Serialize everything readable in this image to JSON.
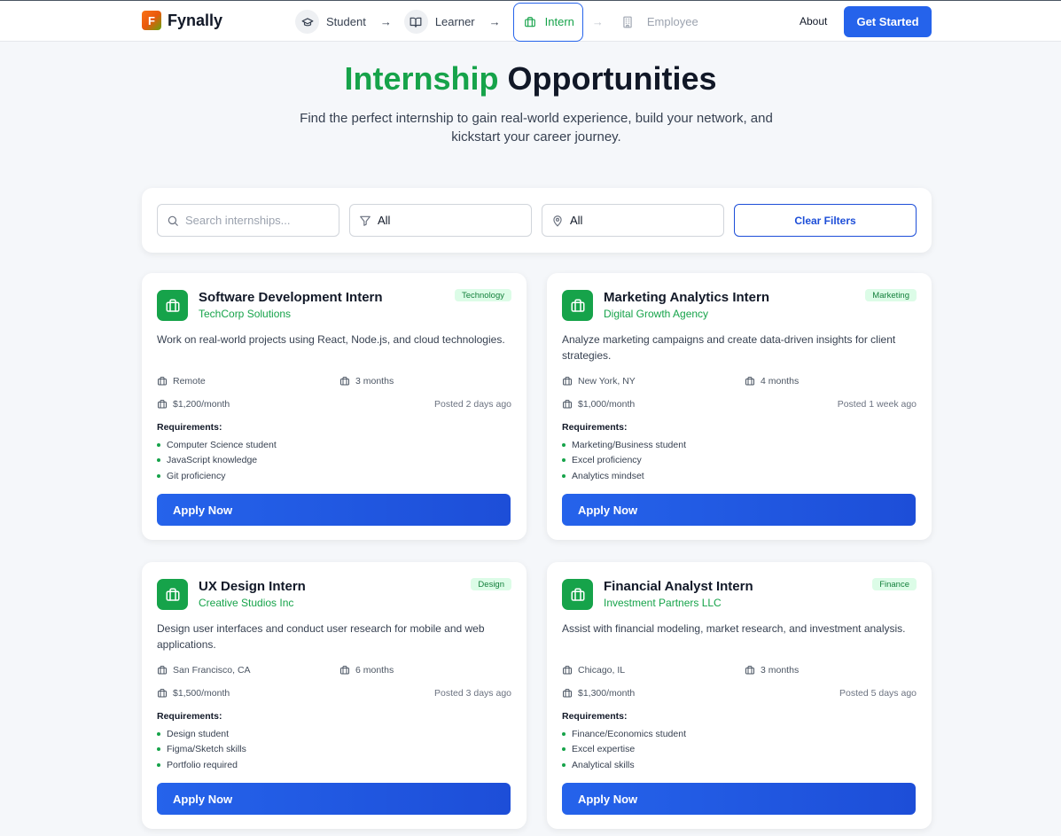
{
  "header": {
    "brand_letter": "F",
    "brand_name": "Fynally",
    "journey": [
      {
        "label": "Student",
        "icon": "graduation-cap-icon"
      },
      {
        "label": "Learner",
        "icon": "book-open-icon"
      },
      {
        "label": "Intern",
        "icon": "briefcase-icon"
      },
      {
        "label": "Employee",
        "icon": "building-icon"
      }
    ],
    "about_label": "About",
    "cta_label": "Get Started"
  },
  "hero": {
    "title_accent": "Internship",
    "title_rest": "Opportunities",
    "subtitle": "Find the perfect internship to gain real-world experience, build your network, and kickstart your career journey."
  },
  "filters": {
    "search_placeholder": "Search internships...",
    "category_value": "All",
    "location_value": "All",
    "clear_label": "Clear Filters"
  },
  "requirements_heading": "Requirements:",
  "apply_label": "Apply Now",
  "colors": {
    "accent_green": "#16a34a",
    "primary_blue": "#2563eb"
  },
  "internships": [
    {
      "title": "Software Development Intern",
      "company": "TechCorp Solutions",
      "tag": "Technology",
      "description": "Work on real-world projects using React, Node.js, and cloud technologies.",
      "location": "Remote",
      "duration": "3 months",
      "stipend": "$1,200/month",
      "posted": "Posted 2 days ago",
      "requirements": [
        "Computer Science student",
        "JavaScript knowledge",
        "Git proficiency"
      ]
    },
    {
      "title": "Marketing Analytics Intern",
      "company": "Digital Growth Agency",
      "tag": "Marketing",
      "description": "Analyze marketing campaigns and create data-driven insights for client strategies.",
      "location": "New York, NY",
      "duration": "4 months",
      "stipend": "$1,000/month",
      "posted": "Posted 1 week ago",
      "requirements": [
        "Marketing/Business student",
        "Excel proficiency",
        "Analytics mindset"
      ]
    },
    {
      "title": "UX Design Intern",
      "company": "Creative Studios Inc",
      "tag": "Design",
      "description": "Design user interfaces and conduct user research for mobile and web applications.",
      "location": "San Francisco, CA",
      "duration": "6 months",
      "stipend": "$1,500/month",
      "posted": "Posted 3 days ago",
      "requirements": [
        "Design student",
        "Figma/Sketch skills",
        "Portfolio required"
      ]
    },
    {
      "title": "Financial Analyst Intern",
      "company": "Investment Partners LLC",
      "tag": "Finance",
      "description": "Assist with financial modeling, market research, and investment analysis.",
      "location": "Chicago, IL",
      "duration": "3 months",
      "stipend": "$1,300/month",
      "posted": "Posted 5 days ago",
      "requirements": [
        "Finance/Economics student",
        "Excel expertise",
        "Analytical skills"
      ]
    }
  ]
}
